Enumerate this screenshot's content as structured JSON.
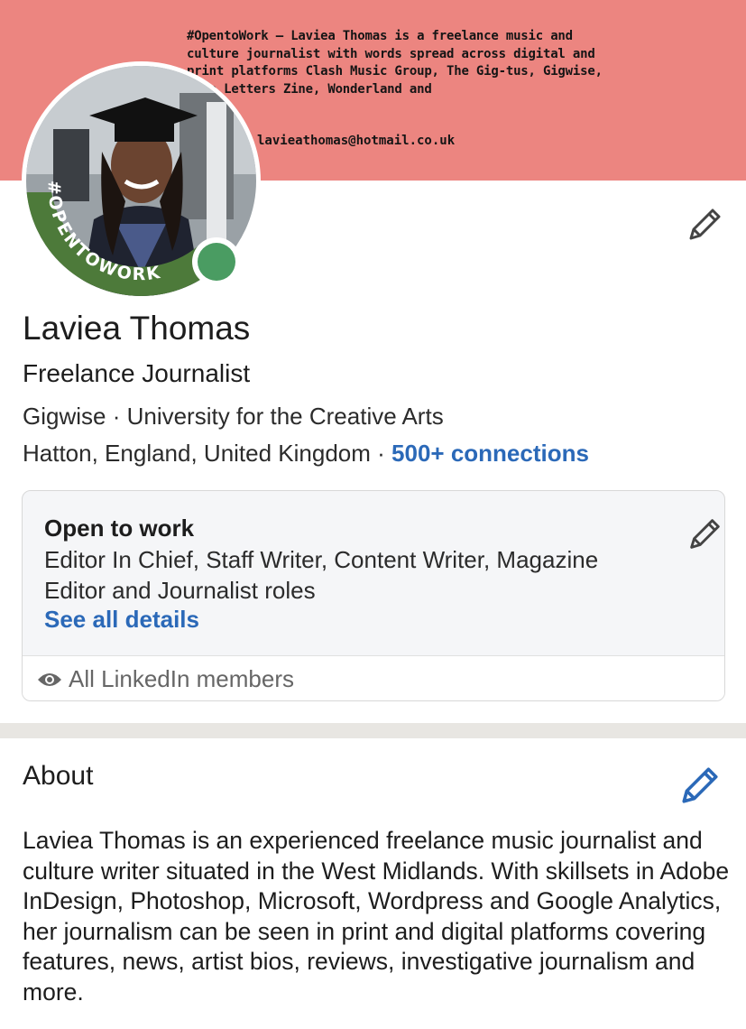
{
  "banner": {
    "text": "#OpentoWork – Laviea Thomas is a freelance music and culture journalist with words spread across digital and print platforms Clash Music Group, The Gig-tus, Gigwise, Love Letters Zine, Wonderland and",
    "email": "lavieathomas@hotmail.co.uk",
    "color": "#ec8580"
  },
  "profile": {
    "avatar_badge": "#OPENTOWORK",
    "name": "Laviea Thomas",
    "headline": "Freelance Journalist",
    "company_school": "Gigwise · University for the Creative Arts",
    "location": "Hatton, England, United Kingdom · ",
    "connections": "500+ connections",
    "online_color": "#4a9c62"
  },
  "open_to_work": {
    "title": "Open to work",
    "roles": "Editor In Chief, Staff Writer, Content Writer, Magazine Editor and Journalist roles",
    "link": "See all details",
    "visibility": "All LinkedIn members"
  },
  "about": {
    "title": "About",
    "text": "Laviea Thomas is an experienced freelance music journalist and culture writer situated in the West Midlands. With skillsets in Adobe InDesign, Photoshop, Microsoft, Wordpress and Google Analytics, her journalism can be seen in print and digital platforms covering features, news, artist bios, reviews, investigative journalism and more."
  },
  "icons": {
    "edit_intro": "pencil-icon",
    "edit_open_to_work": "pencil-icon",
    "edit_about": "pencil-icon",
    "visibility": "eye-icon"
  },
  "colors": {
    "link": "#2b69b8",
    "open_to_work_green": "#4d7a3a"
  }
}
